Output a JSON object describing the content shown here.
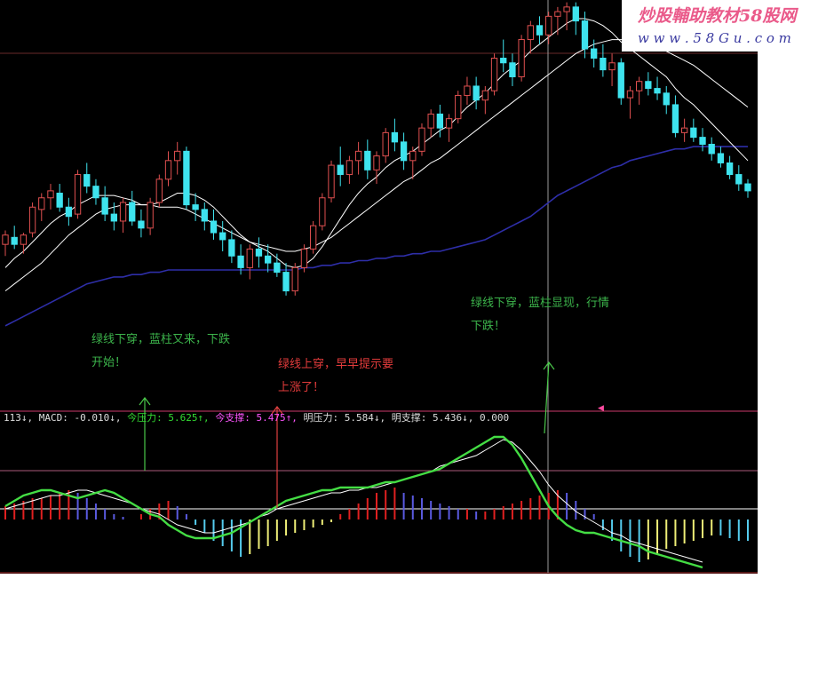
{
  "watermark": {
    "title": "炒股輔助教材58股网",
    "url": "w w w . 5 8 G u . c o m"
  },
  "annotations": [
    {
      "id": "a1",
      "lines": [
        "绿线下穿，蓝柱又来，下跌",
        "开始！"
      ],
      "color": "#3cb44b"
    },
    {
      "id": "a2",
      "lines": [
        "绿线上穿，早早提示要",
        "上涨了！"
      ],
      "color": "#e23b3b"
    },
    {
      "id": "a3",
      "lines": [
        "绿线下穿，蓝柱显现，行情",
        "下跌！"
      ],
      "color": "#3cb44b"
    }
  ],
  "indicator_header": [
    {
      "text": "113↓, MACD: -0.010↓, ",
      "color": "#dddddd"
    },
    {
      "text": "今压力: 5.625↑, ",
      "color": "#33dd33"
    },
    {
      "text": "今支撑: 5.475↑, ",
      "color": "#ff55ff"
    },
    {
      "text": "明压力: 5.584↓, ",
      "color": "#dddddd"
    },
    {
      "text": "明支撑: 5.436↓, 0.000",
      "color": "#dddddd"
    }
  ],
  "colors": {
    "background": "#000000",
    "up_candle": "#e05050",
    "down_candle": "#3ee3ee",
    "ma_short": "#ffffff",
    "ma_long": "#2e2ea8",
    "dif_line": "#44dd44",
    "dea_line": "#ffffff",
    "hist_red": "#e02020",
    "hist_blue": "#5a5ae0",
    "hist_cyan": "#55ccee",
    "hist_yellow": "#eeee77"
  },
  "chart_data": [
    {
      "type": "candlestick",
      "title": "",
      "candles_ohlc": [
        [
          5.3,
          5.36,
          5.25,
          5.34
        ],
        [
          5.33,
          5.38,
          5.28,
          5.3
        ],
        [
          5.3,
          5.35,
          5.26,
          5.34
        ],
        [
          5.35,
          5.48,
          5.33,
          5.46
        ],
        [
          5.45,
          5.52,
          5.4,
          5.5
        ],
        [
          5.5,
          5.56,
          5.45,
          5.53
        ],
        [
          5.52,
          5.56,
          5.44,
          5.46
        ],
        [
          5.46,
          5.5,
          5.38,
          5.42
        ],
        [
          5.43,
          5.62,
          5.41,
          5.6
        ],
        [
          5.6,
          5.65,
          5.52,
          5.55
        ],
        [
          5.55,
          5.58,
          5.47,
          5.5
        ],
        [
          5.5,
          5.55,
          5.4,
          5.43
        ],
        [
          5.43,
          5.48,
          5.36,
          5.4
        ],
        [
          5.4,
          5.5,
          5.35,
          5.48
        ],
        [
          5.48,
          5.53,
          5.38,
          5.4
        ],
        [
          5.4,
          5.45,
          5.33,
          5.37
        ],
        [
          5.37,
          5.5,
          5.34,
          5.48
        ],
        [
          5.48,
          5.6,
          5.46,
          5.58
        ],
        [
          5.58,
          5.7,
          5.55,
          5.66
        ],
        [
          5.66,
          5.74,
          5.6,
          5.7
        ],
        [
          5.7,
          5.72,
          5.45,
          5.47
        ],
        [
          5.47,
          5.52,
          5.4,
          5.45
        ],
        [
          5.45,
          5.48,
          5.36,
          5.4
        ],
        [
          5.4,
          5.45,
          5.32,
          5.35
        ],
        [
          5.35,
          5.4,
          5.27,
          5.32
        ],
        [
          5.32,
          5.36,
          5.22,
          5.25
        ],
        [
          5.25,
          5.3,
          5.17,
          5.2
        ],
        [
          5.2,
          5.3,
          5.15,
          5.28
        ],
        [
          5.28,
          5.33,
          5.2,
          5.25
        ],
        [
          5.25,
          5.3,
          5.18,
          5.22
        ],
        [
          5.22,
          5.26,
          5.16,
          5.18
        ],
        [
          5.18,
          5.22,
          5.08,
          5.1
        ],
        [
          5.1,
          5.22,
          5.08,
          5.2
        ],
        [
          5.2,
          5.3,
          5.18,
          5.28
        ],
        [
          5.28,
          5.4,
          5.26,
          5.38
        ],
        [
          5.38,
          5.52,
          5.36,
          5.5
        ],
        [
          5.5,
          5.66,
          5.48,
          5.64
        ],
        [
          5.64,
          5.72,
          5.55,
          5.6
        ],
        [
          5.6,
          5.68,
          5.56,
          5.66
        ],
        [
          5.66,
          5.74,
          5.6,
          5.7
        ],
        [
          5.7,
          5.75,
          5.58,
          5.62
        ],
        [
          5.62,
          5.7,
          5.56,
          5.68
        ],
        [
          5.68,
          5.8,
          5.65,
          5.78
        ],
        [
          5.78,
          5.84,
          5.7,
          5.74
        ],
        [
          5.74,
          5.78,
          5.62,
          5.66
        ],
        [
          5.66,
          5.72,
          5.58,
          5.7
        ],
        [
          5.7,
          5.82,
          5.68,
          5.8
        ],
        [
          5.8,
          5.88,
          5.76,
          5.86
        ],
        [
          5.86,
          5.9,
          5.76,
          5.8
        ],
        [
          5.8,
          5.86,
          5.74,
          5.84
        ],
        [
          5.84,
          5.96,
          5.82,
          5.94
        ],
        [
          5.94,
          6.02,
          5.9,
          5.98
        ],
        [
          5.98,
          6.02,
          5.88,
          5.92
        ],
        [
          5.92,
          5.98,
          5.86,
          5.96
        ],
        [
          5.96,
          6.12,
          5.94,
          6.1
        ],
        [
          6.1,
          6.18,
          6.04,
          6.08
        ],
        [
          6.08,
          6.12,
          5.98,
          6.02
        ],
        [
          6.02,
          6.2,
          6.0,
          6.18
        ],
        [
          6.18,
          6.26,
          6.12,
          6.24
        ],
        [
          6.24,
          6.28,
          6.16,
          6.2
        ],
        [
          6.2,
          6.3,
          6.16,
          6.28
        ],
        [
          6.28,
          6.32,
          6.2,
          6.3
        ],
        [
          6.3,
          6.34,
          6.22,
          6.32
        ],
        [
          6.32,
          6.34,
          6.2,
          6.26
        ],
        [
          6.26,
          6.3,
          6.1,
          6.14
        ],
        [
          6.14,
          6.18,
          6.06,
          6.1
        ],
        [
          6.1,
          6.16,
          6.02,
          6.05
        ],
        [
          6.05,
          6.12,
          5.98,
          6.08
        ],
        [
          6.08,
          6.1,
          5.9,
          5.93
        ],
        [
          5.93,
          5.98,
          5.84,
          5.96
        ],
        [
          5.96,
          6.02,
          5.9,
          6.0
        ],
        [
          6.0,
          6.04,
          5.94,
          5.97
        ],
        [
          5.97,
          6.02,
          5.92,
          5.95
        ],
        [
          5.95,
          5.98,
          5.86,
          5.9
        ],
        [
          5.9,
          5.94,
          5.76,
          5.78
        ],
        [
          5.78,
          5.84,
          5.74,
          5.8
        ],
        [
          5.8,
          5.84,
          5.74,
          5.76
        ],
        [
          5.76,
          5.8,
          5.7,
          5.73
        ],
        [
          5.73,
          5.76,
          5.66,
          5.69
        ],
        [
          5.69,
          5.72,
          5.63,
          5.65
        ],
        [
          5.65,
          5.68,
          5.58,
          5.6
        ],
        [
          5.6,
          5.64,
          5.53,
          5.56
        ],
        [
          5.56,
          5.58,
          5.5,
          5.53
        ]
      ],
      "ma_short": [
        5.2,
        5.24,
        5.27,
        5.31,
        5.35,
        5.39,
        5.42,
        5.44,
        5.47,
        5.49,
        5.51,
        5.51,
        5.51,
        5.5,
        5.49,
        5.47,
        5.47,
        5.48,
        5.5,
        5.52,
        5.52,
        5.51,
        5.49,
        5.46,
        5.42,
        5.38,
        5.34,
        5.31,
        5.29,
        5.27,
        5.24,
        5.21,
        5.2,
        5.21,
        5.24,
        5.29,
        5.35,
        5.41,
        5.47,
        5.52,
        5.56,
        5.59,
        5.63,
        5.66,
        5.68,
        5.7,
        5.73,
        5.76,
        5.79,
        5.81,
        5.85,
        5.89,
        5.92,
        5.95,
        5.99,
        6.03,
        6.06,
        6.09,
        6.13,
        6.16,
        6.19,
        6.22,
        6.25,
        6.27,
        6.27,
        6.26,
        6.24,
        6.21,
        6.17,
        6.14,
        6.11,
        6.08,
        6.05,
        6.02,
        5.97,
        5.93,
        5.9,
        5.86,
        5.82,
        5.78,
        5.74,
        5.7,
        5.66
      ],
      "ma_mid": [
        5.1,
        5.13,
        5.16,
        5.19,
        5.22,
        5.26,
        5.3,
        5.34,
        5.37,
        5.4,
        5.43,
        5.45,
        5.46,
        5.47,
        5.47,
        5.47,
        5.47,
        5.46,
        5.46,
        5.46,
        5.45,
        5.43,
        5.41,
        5.39,
        5.37,
        5.35,
        5.33,
        5.31,
        5.3,
        5.29,
        5.28,
        5.27,
        5.27,
        5.28,
        5.29,
        5.31,
        5.33,
        5.36,
        5.39,
        5.42,
        5.45,
        5.48,
        5.51,
        5.54,
        5.57,
        5.59,
        5.62,
        5.65,
        5.67,
        5.7,
        5.73,
        5.76,
        5.79,
        5.82,
        5.85,
        5.88,
        5.91,
        5.94,
        5.97,
        6.0,
        6.03,
        6.06,
        6.09,
        6.12,
        6.14,
        6.16,
        6.17,
        6.18,
        6.18,
        6.18,
        6.17,
        6.16,
        6.15,
        6.13,
        6.11,
        6.09,
        6.07,
        6.04,
        6.01,
        5.98,
        5.95,
        5.92,
        5.89
      ],
      "ma_long": [
        4.95,
        4.97,
        4.99,
        5.01,
        5.03,
        5.05,
        5.07,
        5.09,
        5.11,
        5.13,
        5.14,
        5.15,
        5.16,
        5.16,
        5.17,
        5.17,
        5.18,
        5.18,
        5.19,
        5.19,
        5.19,
        5.19,
        5.19,
        5.19,
        5.19,
        5.19,
        5.19,
        5.19,
        5.19,
        5.19,
        5.19,
        5.19,
        5.19,
        5.2,
        5.2,
        5.21,
        5.21,
        5.22,
        5.22,
        5.23,
        5.23,
        5.24,
        5.24,
        5.25,
        5.25,
        5.26,
        5.26,
        5.27,
        5.27,
        5.28,
        5.29,
        5.3,
        5.31,
        5.32,
        5.34,
        5.36,
        5.38,
        5.4,
        5.42,
        5.45,
        5.48,
        5.51,
        5.53,
        5.55,
        5.57,
        5.59,
        5.61,
        5.63,
        5.64,
        5.66,
        5.67,
        5.68,
        5.69,
        5.7,
        5.71,
        5.71,
        5.72,
        5.72,
        5.72,
        5.72,
        5.72,
        5.72,
        5.72
      ],
      "xlabel": "",
      "ylabel": "",
      "ylim": [
        4.9,
        6.35
      ],
      "grid": false
    },
    {
      "type": "bar",
      "title": "MACD",
      "histogram": [
        0.05,
        0.06,
        0.07,
        0.08,
        0.08,
        0.09,
        0.1,
        0.11,
        0.1,
        0.08,
        0.06,
        0.04,
        0.02,
        0.01,
        0.0,
        0.02,
        0.04,
        0.06,
        0.07,
        0.05,
        0.02,
        -0.02,
        -0.05,
        -0.08,
        -0.1,
        -0.12,
        -0.14,
        -0.13,
        -0.11,
        -0.1,
        -0.08,
        -0.06,
        -0.05,
        -0.04,
        -0.03,
        -0.02,
        -0.01,
        0.02,
        0.04,
        0.06,
        0.08,
        0.1,
        0.11,
        0.12,
        0.1,
        0.09,
        0.08,
        0.07,
        0.06,
        0.05,
        0.04,
        0.04,
        0.03,
        0.03,
        0.04,
        0.05,
        0.06,
        0.07,
        0.08,
        0.09,
        0.1,
        0.11,
        0.1,
        0.07,
        0.04,
        0.02,
        -0.04,
        -0.08,
        -0.12,
        -0.14,
        -0.16,
        -0.15,
        -0.13,
        -0.11,
        -0.1,
        -0.09,
        -0.08,
        -0.07,
        -0.06,
        -0.06,
        -0.07,
        -0.08,
        -0.08
      ],
      "dif": [
        0.05,
        0.07,
        0.09,
        0.1,
        0.11,
        0.11,
        0.1,
        0.09,
        0.08,
        0.09,
        0.1,
        0.11,
        0.1,
        0.08,
        0.06,
        0.04,
        0.02,
        0.01,
        -0.02,
        -0.04,
        -0.06,
        -0.07,
        -0.07,
        -0.07,
        -0.06,
        -0.05,
        -0.03,
        -0.01,
        0.01,
        0.03,
        0.05,
        0.07,
        0.08,
        0.09,
        0.1,
        0.11,
        0.11,
        0.12,
        0.12,
        0.12,
        0.12,
        0.13,
        0.14,
        0.14,
        0.15,
        0.16,
        0.17,
        0.18,
        0.19,
        0.21,
        0.23,
        0.25,
        0.27,
        0.29,
        0.31,
        0.31,
        0.28,
        0.23,
        0.17,
        0.11,
        0.05,
        0.01,
        -0.02,
        -0.04,
        -0.05,
        -0.05,
        -0.06,
        -0.07,
        -0.08,
        -0.09,
        -0.1,
        -0.12,
        -0.13,
        -0.14,
        -0.15,
        -0.16,
        -0.17,
        -0.18
      ],
      "dea": [
        0.04,
        0.05,
        0.06,
        0.07,
        0.08,
        0.09,
        0.09,
        0.1,
        0.11,
        0.11,
        0.1,
        0.09,
        0.08,
        0.07,
        0.06,
        0.04,
        0.03,
        0.02,
        0.0,
        -0.02,
        -0.03,
        -0.04,
        -0.05,
        -0.05,
        -0.04,
        -0.03,
        -0.02,
        -0.01,
        0.01,
        0.02,
        0.04,
        0.05,
        0.06,
        0.07,
        0.08,
        0.09,
        0.1,
        0.1,
        0.11,
        0.11,
        0.12,
        0.12,
        0.13,
        0.14,
        0.15,
        0.16,
        0.17,
        0.18,
        0.2,
        0.21,
        0.22,
        0.23,
        0.24,
        0.26,
        0.28,
        0.3,
        0.29,
        0.26,
        0.22,
        0.18,
        0.13,
        0.09,
        0.06,
        0.03,
        0.01,
        -0.01,
        -0.03,
        -0.05,
        -0.06,
        -0.08,
        -0.09,
        -0.1,
        -0.11,
        -0.12,
        -0.13,
        -0.14,
        -0.15,
        -0.16
      ],
      "ylim": [
        -0.2,
        0.35
      ]
    }
  ]
}
